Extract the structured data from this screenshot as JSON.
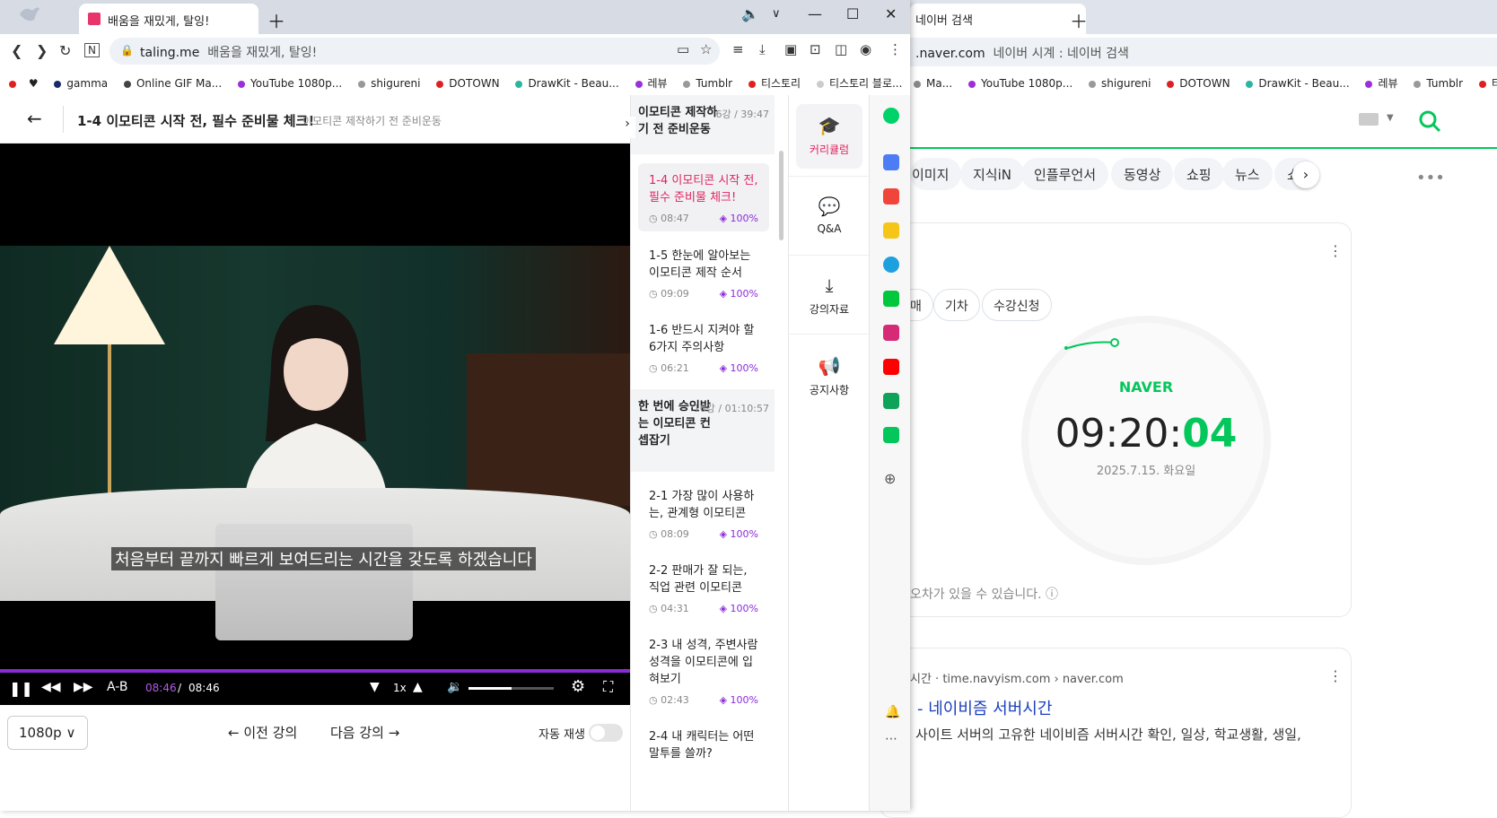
{
  "back": {
    "tab_title": "네이버 검색",
    "url": ".naver.com",
    "page_title": "네이버 시계 : 네이버 검색",
    "bookmarks": [
      {
        "label": "Ma...",
        "color": "#888888"
      },
      {
        "label": "YouTube 1080p...",
        "color": "#9b30d9"
      },
      {
        "label": "shigureni",
        "color": "#999999"
      },
      {
        "label": "DOTOWN",
        "color": "#e02020"
      },
      {
        "label": "DrawKit - Beau...",
        "color": "#2ab5a0"
      },
      {
        "label": "레뷰",
        "color": "#9b30d9"
      },
      {
        "label": "Tumblr",
        "color": "#999999"
      },
      {
        "label": "티",
        "color": "#e02020"
      }
    ],
    "nav_tabs": [
      "이미지",
      "지식iN",
      "인플루언서",
      "동영상",
      "쇼핑",
      "뉴스",
      "쇼"
    ],
    "chips": [
      "매",
      "기차",
      "수강신청"
    ],
    "clock": {
      "brand": "NAVER",
      "time_hm": "09:20:",
      "time_s": "04",
      "date": "2025.7.15. 화요일"
    },
    "disclaimer": "오차가 있을 수 있습니다.",
    "result": {
      "source": "시간 · time.navyism.com › naver.com",
      "title": "- 네이비즘 서버시간",
      "desc": "사이트 서버의 고유한 네이비즘 서버시간 확인, 일상, 학교생활, 생일,"
    }
  },
  "front": {
    "tab_title": "배움을 재밌게, 탈잉!",
    "url_host": "taling.me",
    "url_title": "배움을 재밌게, 탈잉!",
    "bookmarks": [
      {
        "label": "",
        "color": "#e02020"
      },
      {
        "label": "♥",
        "color": "#222222"
      },
      {
        "label": "gamma",
        "color": "#1a2a6c"
      },
      {
        "label": "Online GIF Ma...",
        "color": "#444444"
      },
      {
        "label": "YouTube 1080p...",
        "color": "#9b30d9"
      },
      {
        "label": "shigureni",
        "color": "#999999"
      },
      {
        "label": "DOTOWN",
        "color": "#e02020"
      },
      {
        "label": "DrawKit - Beau...",
        "color": "#2ab5a0"
      },
      {
        "label": "레뷰",
        "color": "#9b30d9"
      },
      {
        "label": "Tumblr",
        "color": "#999999"
      },
      {
        "label": "티스토리",
        "color": "#e02020"
      },
      {
        "label": "티스토리 블로...",
        "color": "#cccccc"
      }
    ]
  },
  "lecture": {
    "title": "1-4 이모티콘 시작 전, 필수 준비물 체크!",
    "subtitle": "이모티콘 제작하기 전 준비운동",
    "caption": "처음부터 끝까지 빠르게 보여드리는 시간을 갖도록 하겠습니다",
    "current_time": "08:46",
    "duration": "08:46",
    "progress": 1.0,
    "volume": 0.5,
    "speed": "1x",
    "ab": "A-B",
    "quality": "1080p",
    "prev": "이전 강의",
    "next": "다음 강의",
    "autoplay_label": "자동 재생",
    "autoplay_on": false
  },
  "curriculum": {
    "sections": [
      {
        "title": "이모티콘 제작하기 전 준비운동",
        "meta": "6강 / 39:47"
      },
      {
        "title": "한 번에 승인받는 이모티콘 컨셉잡기",
        "meta": "16강 / 01:10:57"
      }
    ],
    "lectures": [
      {
        "title": "1-4 이모티콘 시작 전, 필수 준비물 체크!",
        "duration": "08:47",
        "pct": "100%",
        "active": true
      },
      {
        "title": "1-5 한눈에 알아보는 이모티콘 제작 순서",
        "duration": "09:09",
        "pct": "100%"
      },
      {
        "title": "1-6 반드시 지켜야 할 6가지 주의사항",
        "duration": "06:21",
        "pct": "100%"
      },
      {
        "title": "2-1 가장 많이 사용하는, 관계형 이모티콘",
        "duration": "08:09",
        "pct": "100%"
      },
      {
        "title": "2-2 판매가 잘 되는, 직업 관련 이모티콘",
        "duration": "04:31",
        "pct": "100%"
      },
      {
        "title": "2-3 내 성격, 주변사람 성격을 이모티콘에 입혀보기",
        "duration": "02:43",
        "pct": "100%"
      },
      {
        "title": "2-4 내 캐릭터는 어떤 말투를 쓸까?",
        "duration": "",
        "pct": ""
      }
    ]
  },
  "side_menu": {
    "curriculum": "커리큘럼",
    "qa": "Q&A",
    "materials": "강의자료",
    "notice": "공지사항"
  }
}
